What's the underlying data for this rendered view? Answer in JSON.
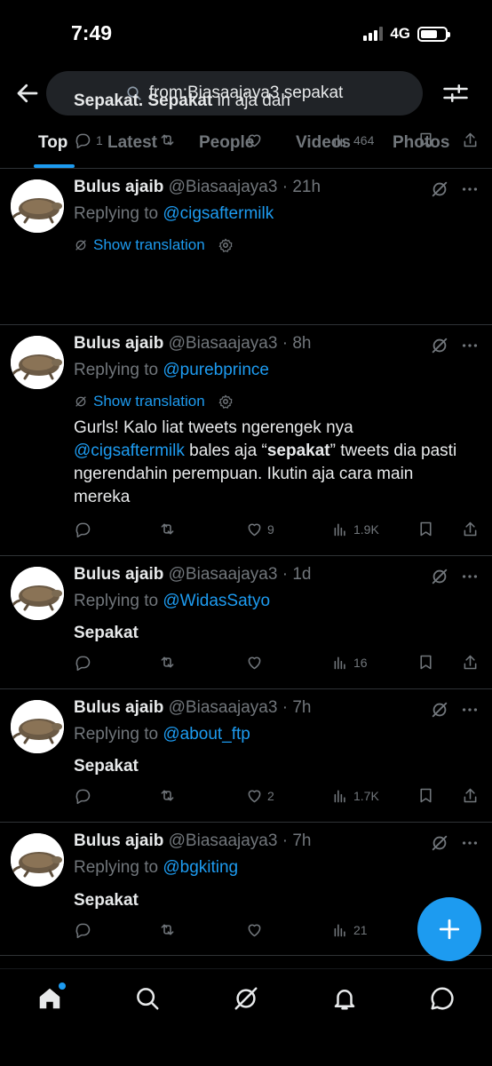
{
  "status": {
    "time": "7:49",
    "network": "4G"
  },
  "search": {
    "query": "from:Biasaajaya3 sepakat"
  },
  "tabs": [
    {
      "label": "Top"
    },
    {
      "label": "Latest"
    },
    {
      "label": "People"
    },
    {
      "label": "Videos"
    },
    {
      "label": "Photos"
    }
  ],
  "tweets": [
    {
      "name": "Bulus ajaib",
      "meta": "@Biasaajaya3 · 21h",
      "replying_prefix": "Replying to",
      "replying_to": "@cigsaftermilk",
      "translation": "Show translation",
      "body_bold1": "Sepakat. Sepakat",
      "body_rest": " in aja dah",
      "replies": "1",
      "retweets": "",
      "likes": "",
      "views": "464"
    },
    {
      "name": "Bulus ajaib",
      "meta": "@Biasaajaya3 · 8h",
      "replying_prefix": "Replying to",
      "replying_to": "@purebprince",
      "translation": "Show translation",
      "body_a": "Gurls! Kalo liat tweets ngerengek nya",
      "body_link": "@cigsaftermilk",
      "body_b": "  bales aja “",
      "body_bold": "sepakat",
      "body_c": "” tweets dia pasti ngerendahin perempuan. Ikutin aja cara main mereka",
      "replies": "",
      "retweets": "",
      "likes": "9",
      "views": "1.9K"
    },
    {
      "name": "Bulus ajaib",
      "meta": "@Biasaajaya3 · 1d",
      "replying_prefix": "Replying to",
      "replying_to": "@WidasSatyo",
      "body": "Sepakat",
      "replies": "",
      "retweets": "",
      "likes": "",
      "views": "16"
    },
    {
      "name": "Bulus ajaib",
      "meta": "@Biasaajaya3 · 7h",
      "replying_prefix": "Replying to",
      "replying_to": "@about_ftp",
      "body": "Sepakat",
      "replies": "",
      "retweets": "",
      "likes": "2",
      "views": "1.7K"
    },
    {
      "name": "Bulus ajaib",
      "meta": "@Biasaajaya3 · 7h",
      "replying_prefix": "Replying to",
      "replying_to": "@bgkiting",
      "body": "Sepakat",
      "replies": "",
      "retweets": "",
      "likes": "",
      "views": "21"
    }
  ],
  "colors": {
    "accent": "#1d9bf0",
    "muted": "#71767b",
    "text": "#e7e9ea",
    "background": "#000000"
  },
  "icons": {
    "back": "arrow-left-icon",
    "search": "search-icon",
    "filter": "sliders-icon",
    "grok": "grok-icon",
    "more": "more-icon",
    "reply": "reply-icon",
    "retweet": "retweet-icon",
    "like": "heart-icon",
    "views": "views-icon",
    "bookmark": "bookmark-icon",
    "share": "share-icon",
    "compose": "plus-icon",
    "home": "home-icon",
    "explore": "search-icon",
    "grok_nav": "grok-icon",
    "notifications": "bell-icon",
    "messages": "chat-icon"
  }
}
